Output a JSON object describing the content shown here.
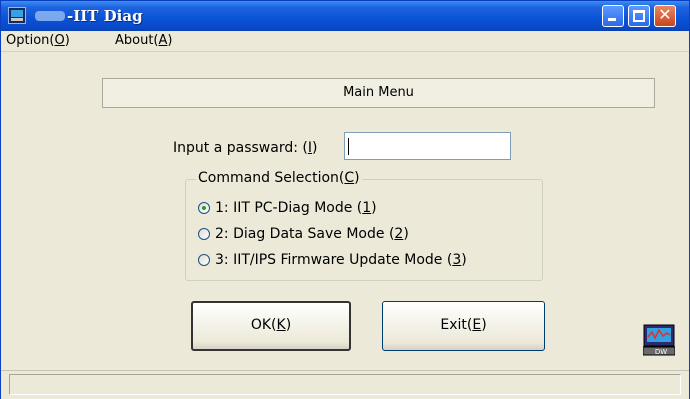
{
  "window": {
    "title": "-IIT Diag",
    "icon": "app-monitor-icon",
    "controls": [
      "minimize-icon",
      "maximize-icon",
      "close-icon"
    ],
    "colors": {
      "titlebar": "#0a52d6",
      "face": "#ece9d8"
    }
  },
  "menu": {
    "option": {
      "label": "Option(",
      "key": "O",
      "end": ")"
    },
    "about": {
      "label": "About(",
      "key": "A",
      "end": ")"
    }
  },
  "header": {
    "title": "Main Menu"
  },
  "password": {
    "label": "Input a passward: (",
    "key": "I",
    "end": ")",
    "value": ""
  },
  "commands": {
    "title": "Command Selection(",
    "key": "C",
    "end": ")",
    "options": [
      {
        "label": "1: IIT PC-Diag Mode (",
        "key": "1",
        "end": ")",
        "selected": true
      },
      {
        "label": "2: Diag Data Save Mode (",
        "key": "2",
        "end": ")",
        "selected": false
      },
      {
        "label": "3: IIT/IPS Firmware Update Mode (",
        "key": "3",
        "end": ")",
        "selected": false
      }
    ]
  },
  "buttons": {
    "ok": {
      "label": "OK(",
      "key": "K",
      "end": ")"
    },
    "exit": {
      "label": "Exit(",
      "key": "E",
      "end": ")"
    }
  },
  "corner_icon": {
    "icon": "diag-monitor-icon",
    "text": "DW"
  }
}
